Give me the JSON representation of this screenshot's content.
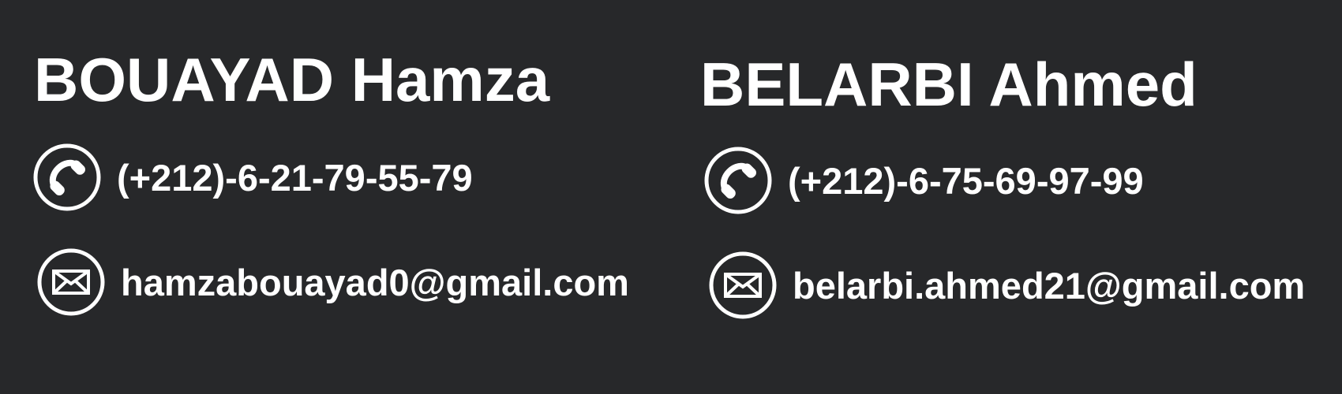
{
  "contacts": [
    {
      "name": "BOUAYAD Hamza",
      "phone_icon": "phone-icon",
      "phone": "(+212)-6-21-79-55-79",
      "email_icon": "envelope-icon",
      "email": "hamzabouayad0@gmail.com"
    },
    {
      "name": "BELARBI Ahmed",
      "phone_icon": "phone-icon",
      "phone": "(+212)-6-75-69-97-99",
      "email_icon": "envelope-icon",
      "email": "belarbi.ahmed21@gmail.com"
    }
  ],
  "colors": {
    "background": "#27282a",
    "text": "#ffffff"
  }
}
